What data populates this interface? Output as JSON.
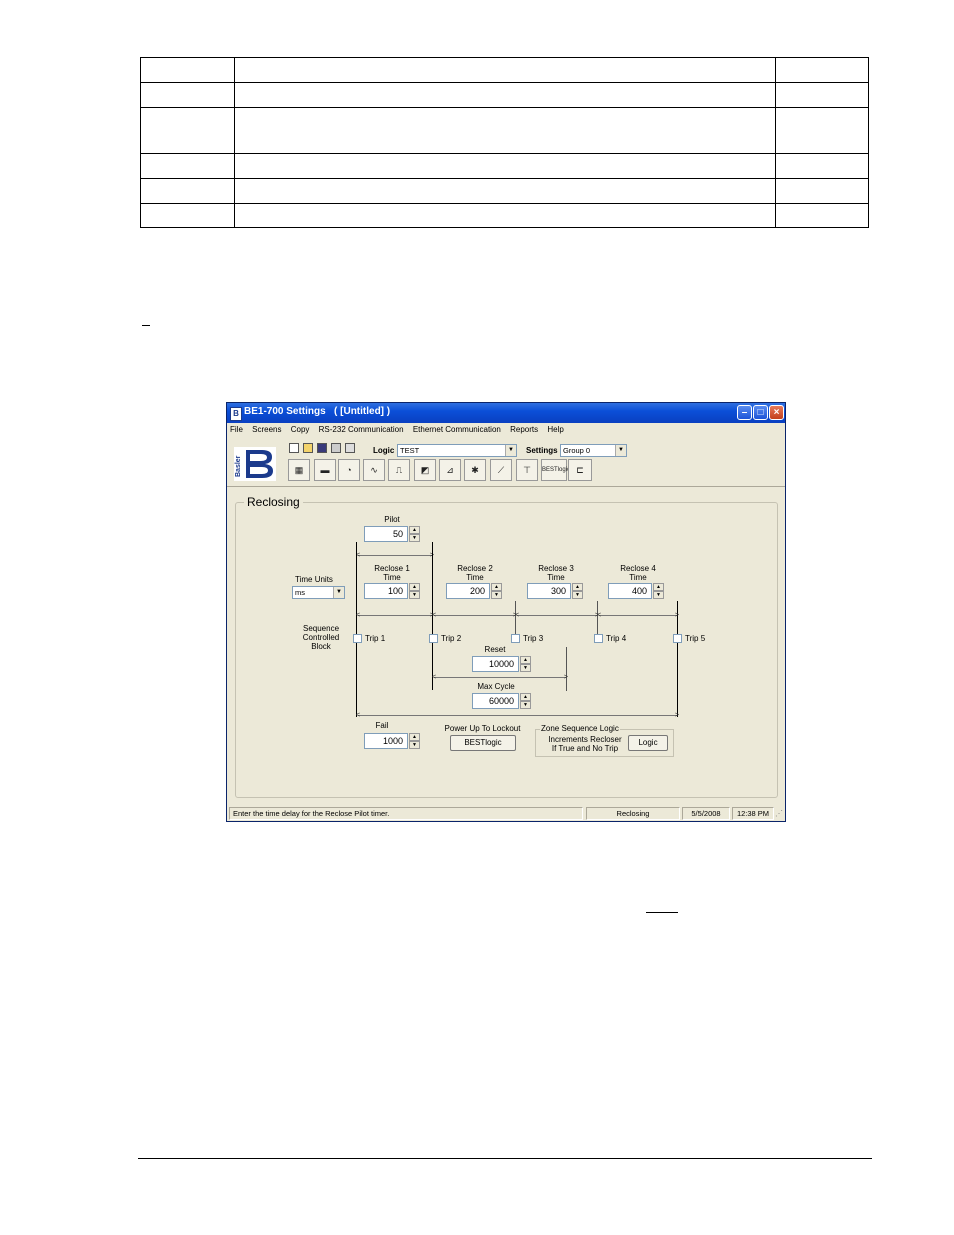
{
  "window": {
    "title": "BE1-700 Settings   ( [Untitled] )",
    "menu": [
      "File",
      "Screens",
      "Copy",
      "RS-232 Communication",
      "Ethernet Communication",
      "Reports",
      "Help"
    ],
    "logo_text": "Basler",
    "logic_label": "Logic",
    "logic_value": "TEST",
    "settings_label": "Settings",
    "settings_value": "Group 0",
    "toolbar_beslogic": "BESTlogic"
  },
  "reclosing": {
    "group_title": "Reclosing",
    "pilot_label": "Pilot",
    "pilot_value": "50",
    "time_units_label": "Time Units",
    "time_units_value": "ms",
    "reclose1_label": "Reclose 1",
    "reclose1_sub": "Time",
    "reclose1_value": "100",
    "reclose2_label": "Reclose 2",
    "reclose2_sub": "Time",
    "reclose2_value": "200",
    "reclose3_label": "Reclose 3",
    "reclose3_sub": "Time",
    "reclose3_value": "300",
    "reclose4_label": "Reclose 4",
    "reclose4_sub": "Time",
    "reclose4_value": "400",
    "scb_line1": "Sequence",
    "scb_line2": "Controlled",
    "scb_line3": "Block",
    "trips": [
      "Trip 1",
      "Trip 2",
      "Trip 3",
      "Trip 4",
      "Trip 5"
    ],
    "reset_label": "Reset",
    "reset_value": "10000",
    "max_cycle_label": "Max Cycle",
    "max_cycle_value": "60000",
    "fail_label": "Fail",
    "fail_value": "1000",
    "power_up_label": "Power Up To Lockout",
    "power_up_button": "BESTlogic",
    "zone_title": "Zone Sequence Logic",
    "zone_line1": "Increments Recloser",
    "zone_line2": "If True and No Trip",
    "zone_button": "Logic"
  },
  "status": {
    "hint": "Enter the time delay for the Reclose Pilot timer.",
    "screen": "Reclosing",
    "date": "5/5/2008",
    "time": "12:38 PM"
  }
}
